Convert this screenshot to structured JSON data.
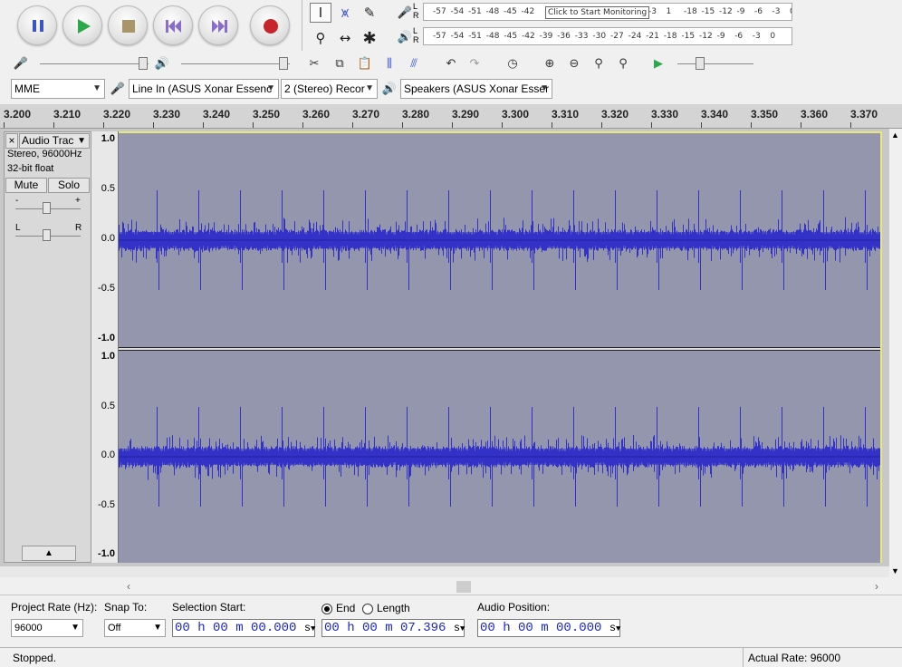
{
  "transport": {
    "pause_icon": "pause-icon",
    "play_icon": "play-icon",
    "stop_icon": "stop-icon",
    "skip_start_icon": "skip-to-start-icon",
    "skip_end_icon": "skip-to-end-icon",
    "record_icon": "record-icon"
  },
  "meters": {
    "record_channels": "L\nR",
    "play_channels": "L\nR",
    "record_scale": [
      "-57",
      "-54",
      "-51",
      "-48",
      "-45",
      "-42",
      "-3",
      "1",
      "-18",
      "-15",
      "-12",
      "-9",
      "-6",
      "-3",
      "0"
    ],
    "play_scale": [
      "-57",
      "-54",
      "-51",
      "-48",
      "-45",
      "-42",
      "-39",
      "-36",
      "-33",
      "-30",
      "-27",
      "-24",
      "-21",
      "-18",
      "-15",
      "-12",
      "-9",
      "-6",
      "-3",
      "0"
    ],
    "record_tip": "Click to Start Monitoring"
  },
  "device": {
    "host": "MME",
    "recording_device": "Line In (ASUS Xonar Essenc",
    "recording_channels": "2 (Stereo) Recor",
    "playback_device": "Speakers (ASUS Xonar Esser"
  },
  "ruler": {
    "ticks": [
      "3.200",
      "3.210",
      "3.220",
      "3.230",
      "3.240",
      "3.250",
      "3.260",
      "3.270",
      "3.280",
      "3.290",
      "3.300",
      "3.310",
      "3.320",
      "3.330",
      "3.340",
      "3.350",
      "3.360",
      "3.370"
    ]
  },
  "track": {
    "name": "Audio Trac",
    "format": "Stereo, 96000Hz",
    "bit_depth": "32-bit float",
    "mute_label": "Mute",
    "solo_label": "Solo",
    "gain_minus": "-",
    "gain_plus": "+",
    "pan_left": "L",
    "pan_right": "R",
    "close_label": "×",
    "menu_arrow": "▼",
    "collapse_label": "▲",
    "scale": [
      "1.0",
      "0.5",
      "0.0",
      "-0.5",
      "-1.0"
    ]
  },
  "selection": {
    "project_rate_label": "Project Rate (Hz):",
    "project_rate": "96000",
    "snap_to_label": "Snap To:",
    "snap_to": "Off",
    "selection_start_label": "Selection Start:",
    "selection_start": "00 h 00 m 00.000",
    "end_label": "End",
    "length_label": "Length",
    "selection_end": "00 h 00 m 07.396",
    "audio_position_label": "Audio Position:",
    "audio_position": "00 h 00 m 00.000",
    "seconds_unit": "s"
  },
  "status": {
    "state": "Stopped.",
    "actual_rate": "Actual Rate: 96000"
  },
  "colors": {
    "waveform": "#3232c8",
    "waveform_bg": "#9496ad",
    "time_digits": "#1c27c8",
    "record": "#c8242b",
    "play": "#2aa84a"
  }
}
